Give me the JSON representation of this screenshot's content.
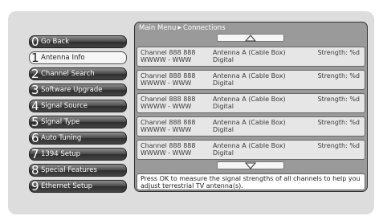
{
  "breadcrumb": {
    "parent": "Main Menu",
    "current": "Connections"
  },
  "menu": [
    {
      "num": "0",
      "label": "Go Back",
      "selected": false
    },
    {
      "num": "1",
      "label": "Antenna Info",
      "selected": true
    },
    {
      "num": "2",
      "label": "Channel Search",
      "selected": false
    },
    {
      "num": "3",
      "label": "Software Upgrade",
      "selected": false
    },
    {
      "num": "4",
      "label": "Signal Source",
      "selected": false
    },
    {
      "num": "5",
      "label": "Signal Type",
      "selected": false
    },
    {
      "num": "6",
      "label": "Auto Tuning",
      "selected": false
    },
    {
      "num": "7",
      "label": "1394 Setup",
      "selected": false
    },
    {
      "num": "8",
      "label": "Special Features",
      "selected": false
    },
    {
      "num": "9",
      "label": "Ethernet Setup",
      "selected": false
    }
  ],
  "channels": [
    {
      "channel": "Channel 888 888",
      "callsign": "WWWW - WWW",
      "antenna": "Antenna A (Cable Box)",
      "type": "Digital",
      "strength": "Strength: %d"
    },
    {
      "channel": "Channel 888 888",
      "callsign": "WWWW - WWW",
      "antenna": "Antenna A (Cable Box)",
      "type": "Digital",
      "strength": "Strength: %d"
    },
    {
      "channel": "Channel 888 888",
      "callsign": "WWWW - WWW",
      "antenna": "Antenna A (Cable Box)",
      "type": "Digital",
      "strength": "Strength: %d"
    },
    {
      "channel": "Channel 888 888",
      "callsign": "WWWW - WWW",
      "antenna": "Antenna A (Cable Box)",
      "type": "Digital",
      "strength": "Strength: %d"
    },
    {
      "channel": "Channel 888 888",
      "callsign": "WWWW - WWW",
      "antenna": "Antenna A (Cable Box)",
      "type": "Digital",
      "strength": "Strength: %d"
    }
  ],
  "help_text": "Press OK to measure the signal strengths of all channels to help you adjust terrestrial TV antenna(s).",
  "icons": {
    "scroll_up": "triangle-up-outline-icon",
    "scroll_down": "triangle-down-outline-icon",
    "separator": "play-arrow-icon"
  }
}
